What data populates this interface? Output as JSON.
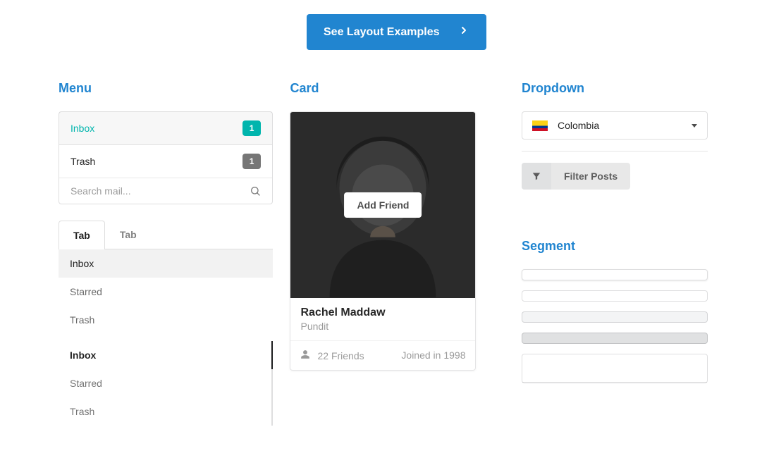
{
  "hero": {
    "button_label": "See Layout Examples"
  },
  "menu": {
    "heading": "Menu",
    "items": [
      {
        "label": "Inbox",
        "badge": "1",
        "active": true
      },
      {
        "label": "Trash",
        "badge": "1",
        "active": false
      }
    ],
    "search_placeholder": "Search mail...",
    "tabs": {
      "a": "Tab",
      "b": "Tab"
    },
    "tablist": {
      "inbox": "Inbox",
      "starred": "Starred",
      "trash": "Trash"
    },
    "vlist2": {
      "inbox": "Inbox",
      "starred": "Starred",
      "trash": "Trash"
    }
  },
  "card": {
    "heading": "Card",
    "add_friend_label": "Add Friend",
    "name": "Rachel Maddaw",
    "subtitle": "Pundit",
    "friends_text": "22 Friends",
    "joined_text": "Joined in 1998"
  },
  "dropdown": {
    "heading": "Dropdown",
    "selected": "Colombia",
    "filter_label": "Filter Posts"
  },
  "segment": {
    "heading": "Segment"
  }
}
